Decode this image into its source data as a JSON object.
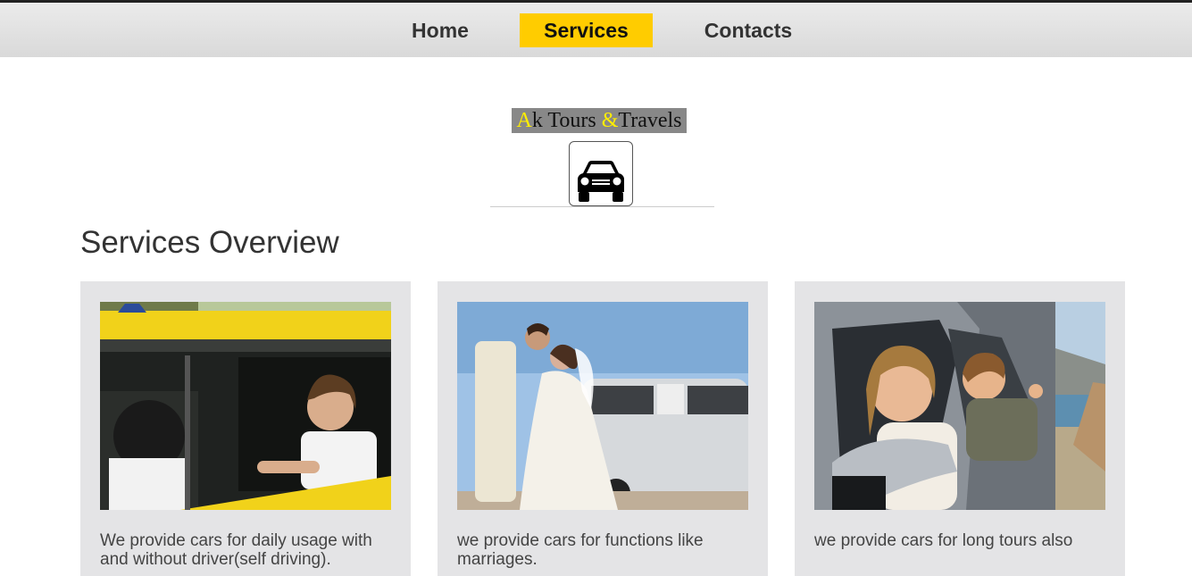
{
  "nav": {
    "home": "Home",
    "services": "Services",
    "contacts": "Contacts"
  },
  "brand": {
    "part1": "A",
    "part2": "k Tours ",
    "part3": "&",
    "part4": "Travels"
  },
  "main": {
    "heading": "Services Overview",
    "cards": [
      {
        "description": "We provide cars for daily usage with and without driver(self driving)."
      },
      {
        "description": "we provide cars for functions like marriages."
      },
      {
        "description": "we provide cars for long tours also"
      }
    ]
  },
  "colors": {
    "accent": "#ffcc00",
    "card_bg": "#e4e4e6",
    "navbar_bg": "#dddddd"
  },
  "icons": {
    "logo": "car-icon"
  }
}
